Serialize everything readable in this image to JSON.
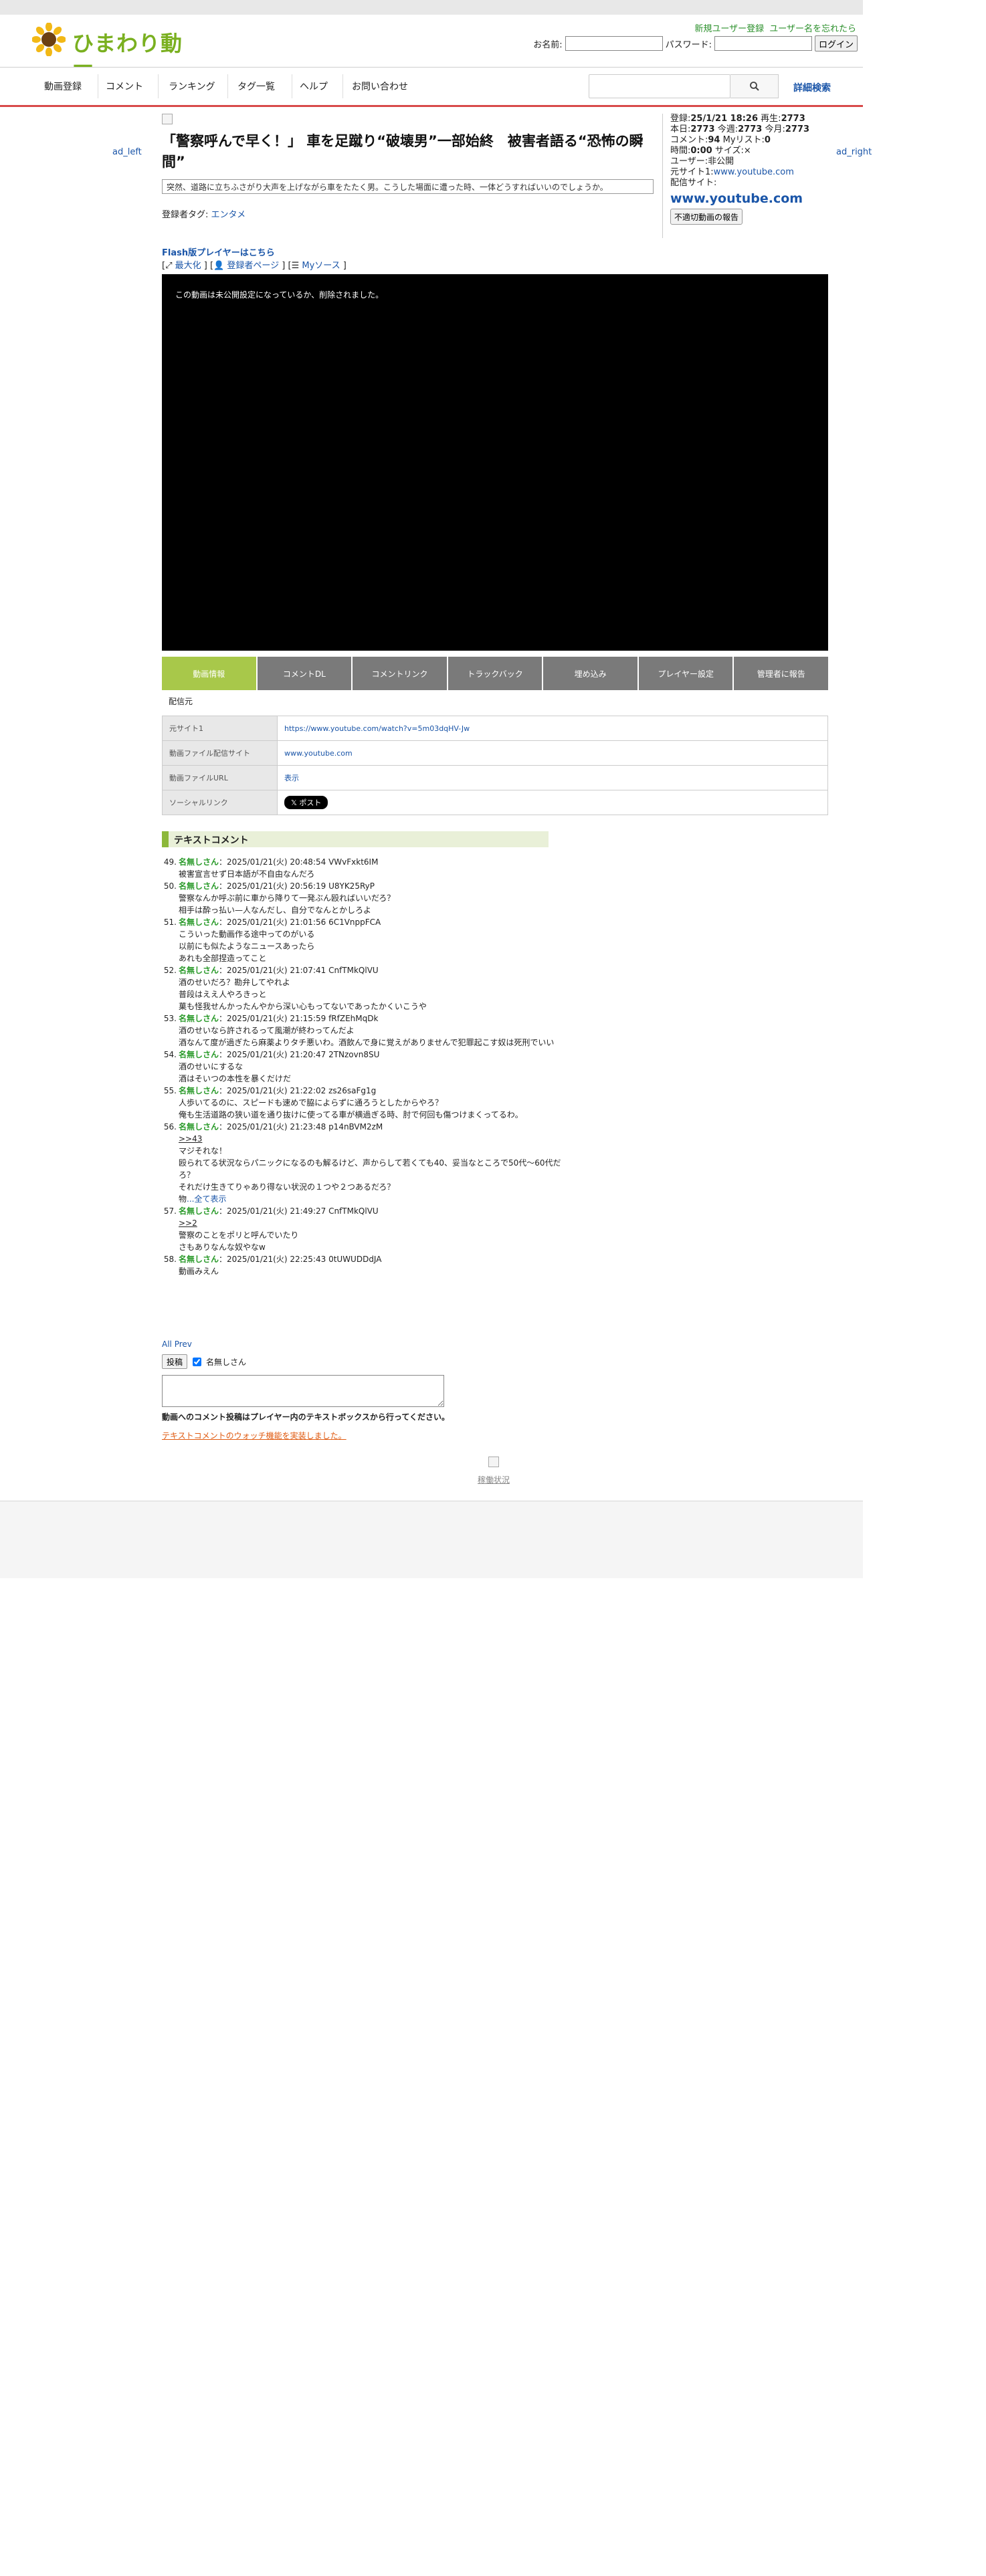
{
  "header": {
    "logo_text": "ひまわり動画",
    "link_register": "新規ユーザー登録",
    "link_forgot": "ユーザー名を忘れたら",
    "name_label": "お名前:",
    "password_label": "パスワード:",
    "login_button": "ログイン"
  },
  "nav": {
    "items": [
      "動画登録",
      "コメント",
      "ランキング",
      "タグ一覧",
      "ヘルプ",
      "お問い合わせ"
    ],
    "advanced_search": "詳細検索"
  },
  "ads": {
    "left": "ad_left",
    "right": "ad_right"
  },
  "video": {
    "title": "「警察呼んで早く！」 車を足蹴り“破壊男”一部始終　被害者語る“恐怖の瞬間”",
    "description": "突然、道路に立ちふさがり大声を上げながら車をたたく男。こうした場面に遭った時、一体どうすればいいのでしょうか。",
    "tags_label": "登録者タグ:",
    "tag": "エンタメ",
    "flash_link": "Flash版プレイヤーはこちら",
    "link_maximize": "最大化",
    "link_uploader": "登録者ページ",
    "link_mysource": "Myソース",
    "player_message": "この動画は未公開設定になっているか、削除されました。"
  },
  "info": {
    "registered_label": "登録:",
    "registered": "25/1/21 18:26",
    "plays_label": "再生:",
    "plays": "2773",
    "today_label": "本日:",
    "today": "2773",
    "week_label": "今週:",
    "week": "2773",
    "month_label": "今月:",
    "month": "2773",
    "comment_label": "コメント:",
    "comment": "94",
    "mylist_label": "Myリスト:",
    "mylist": "0",
    "time_label": "時間:",
    "time": "0:00",
    "size_label": "サイズ:",
    "size": "×",
    "user_label": "ユーザー:",
    "user": "非公開",
    "source_label": "元サイト1:",
    "source": "www.youtube.com",
    "delivery_label": "配信サイト:",
    "delivery": "www.youtube.com",
    "report_button": "不適切動画の報告"
  },
  "tabs": [
    "動画情報",
    "コメントDL",
    "コメントリンク",
    "トラックバック",
    "埋め込み",
    "プレイヤー設定",
    "管理者に報告"
  ],
  "haishin": "配信元",
  "table": [
    {
      "k": "元サイト1",
      "v": "https://www.youtube.com/watch?v=5m03dqHV-Jw"
    },
    {
      "k": "動画ファイル配信サイト",
      "v": "www.youtube.com"
    },
    {
      "k": "動画ファイルURL",
      "v": "表示"
    },
    {
      "k": "ソーシャルリンク",
      "v": "𝕏 ポスト"
    }
  ],
  "text_comments": {
    "heading": "テキストコメント",
    "items": [
      {
        "num": "49.",
        "name": "名無しさん",
        "meta": "：2025/01/21(火) 20:48:54 VWvFxkt6IM",
        "lines": [
          "被害宣言せず日本語が不自由なんだろ"
        ]
      },
      {
        "num": "50.",
        "name": "名無しさん",
        "meta": "：2025/01/21(火) 20:56:19 U8YK25RyP",
        "lines": [
          "警察なんか呼ぶ前に車から降りて一発ぶん殴ればいいだろ？",
          "相手は酔っ払い—人なんだし、自分でなんとかしろよ"
        ]
      },
      {
        "num": "51.",
        "name": "名無しさん",
        "meta": "：2025/01/21(火) 21:01:56 6C1VnppFCA",
        "lines": [
          "こういった動画作る途中ってのがいる",
          "以前にも似たようなニュースあったら",
          "あれも全部捏造ってこと"
        ]
      },
      {
        "num": "52.",
        "name": "名無しさん",
        "meta": "：2025/01/21(火) 21:07:41 CnfTMkQlVU",
        "lines": [
          "酒のせいだろ？勘弁してやれよ",
          "普段はええ人やろきっと",
          "菓も怪我せんかったんやから深い心もってないであったかくいこうや"
        ]
      },
      {
        "num": "53.",
        "name": "名無しさん",
        "meta": "：2025/01/21(火) 21:15:59 fRfZEhMqDk",
        "lines": [
          "酒のせいなら許されるって風潮が終わってんだよ",
          "酒なんて度が過ぎたら麻薬よりタチ悪いわ。酒飲んで身に覚えがありませんで犯罪起こす奴は死刑でいい"
        ]
      },
      {
        "num": "54.",
        "name": "名無しさん",
        "meta": "：2025/01/21(火) 21:20:47 2TNzovn8SU",
        "lines": [
          "酒のせいにするな",
          "酒はそいつの本性を暴くだけだ"
        ]
      },
      {
        "num": "55.",
        "name": "名無しさん",
        "meta": "：2025/01/21(火) 21:22:02 zs26saFg1g",
        "lines": [
          "人歩いてるのに、スピードも速めで脇によらずに通ろうとしたからやろ？",
          "俺も生活道路の狭い道を通り抜けに使ってる車が横過ぎる時、肘で何回も傷つけまくってるわ。"
        ]
      },
      {
        "num": "56.",
        "name": "名無しさん",
        "meta": "：2025/01/21(火) 21:23:48 p14nBVM2zM",
        "ref": ">>43",
        "lines": [
          "マジそれな！",
          "殴られてる状況ならパニックになるのも解るけど、声からして若くても40、妥当なところで50代〜60代だろ？",
          "それだけ生きてりゃあり得ない状況の１つや２つあるだろ？",
          "物"
        ],
        "more": "...全て表示"
      },
      {
        "num": "57.",
        "name": "名無しさん",
        "meta": "：2025/01/21(火) 21:49:27 CnfTMkQlVU",
        "ref": ">>2",
        "lines": [
          "警察のことをポリと呼んでいたり",
          "さもありなんな奴やなw"
        ]
      },
      {
        "num": "58.",
        "name": "名無しさん",
        "meta": "：2025/01/21(火) 22:25:43 0tUWUDDdJA",
        "lines": [
          "動画みえん"
        ]
      }
    ],
    "all_prev": "All Prev",
    "post_button": "投稿",
    "default_name": "名無しさん",
    "note": "動画へのコメント投稿はプレイヤー内のテキストボックスから行ってください。",
    "watch_note": "テキストコメントのウォッチ機能を実装しました。"
  },
  "footer": {
    "link": "稼働状況"
  },
  "colors": {
    "accent_green": "#a8c84a",
    "nav_red": "#d84a4a",
    "name_green": "#2a9a2a"
  }
}
